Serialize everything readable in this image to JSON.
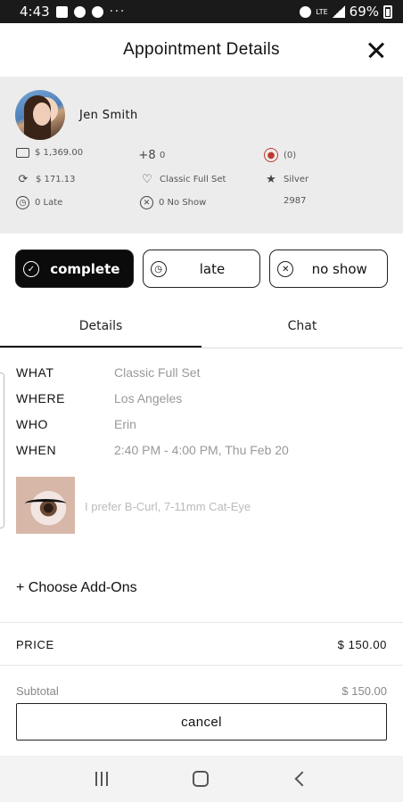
{
  "status_bar": {
    "time": "4:43",
    "dots": "···",
    "network": "LTE",
    "battery": "69%"
  },
  "header": {
    "title": "Appointment Details"
  },
  "client": {
    "name": "Jen Smith",
    "stats": {
      "total_spent": "$ 1,369.00",
      "referrals": "0",
      "alerts": "(0)",
      "average": "$ 171.13",
      "favorite_service": "Classic Full Set",
      "tier": "Silver",
      "late_count": "0 Late",
      "no_show_count": "0 No Show",
      "points": "2987"
    }
  },
  "actions": {
    "complete": "complete",
    "late": "late",
    "no_show": "no show"
  },
  "tabs": [
    {
      "label": "Details"
    },
    {
      "label": "Chat"
    }
  ],
  "details": {
    "what_label": "WHAT",
    "what": "Classic Full Set",
    "where_label": "WHERE",
    "where": "Los Angeles",
    "who_label": "WHO",
    "who": "Erin",
    "when_label": "WHEN",
    "when": "2:40 PM - 4:00 PM, Thu Feb 20",
    "note": "I prefer B-Curl, 7-11mm Cat-Eye"
  },
  "addons_label": "+ Choose Add-Ons",
  "pricing": {
    "price_label": "PRICE",
    "price": "$ 150.00",
    "subtotal_label": "Subtotal",
    "subtotal": "$ 150.00"
  },
  "cancel_label": "cancel"
}
